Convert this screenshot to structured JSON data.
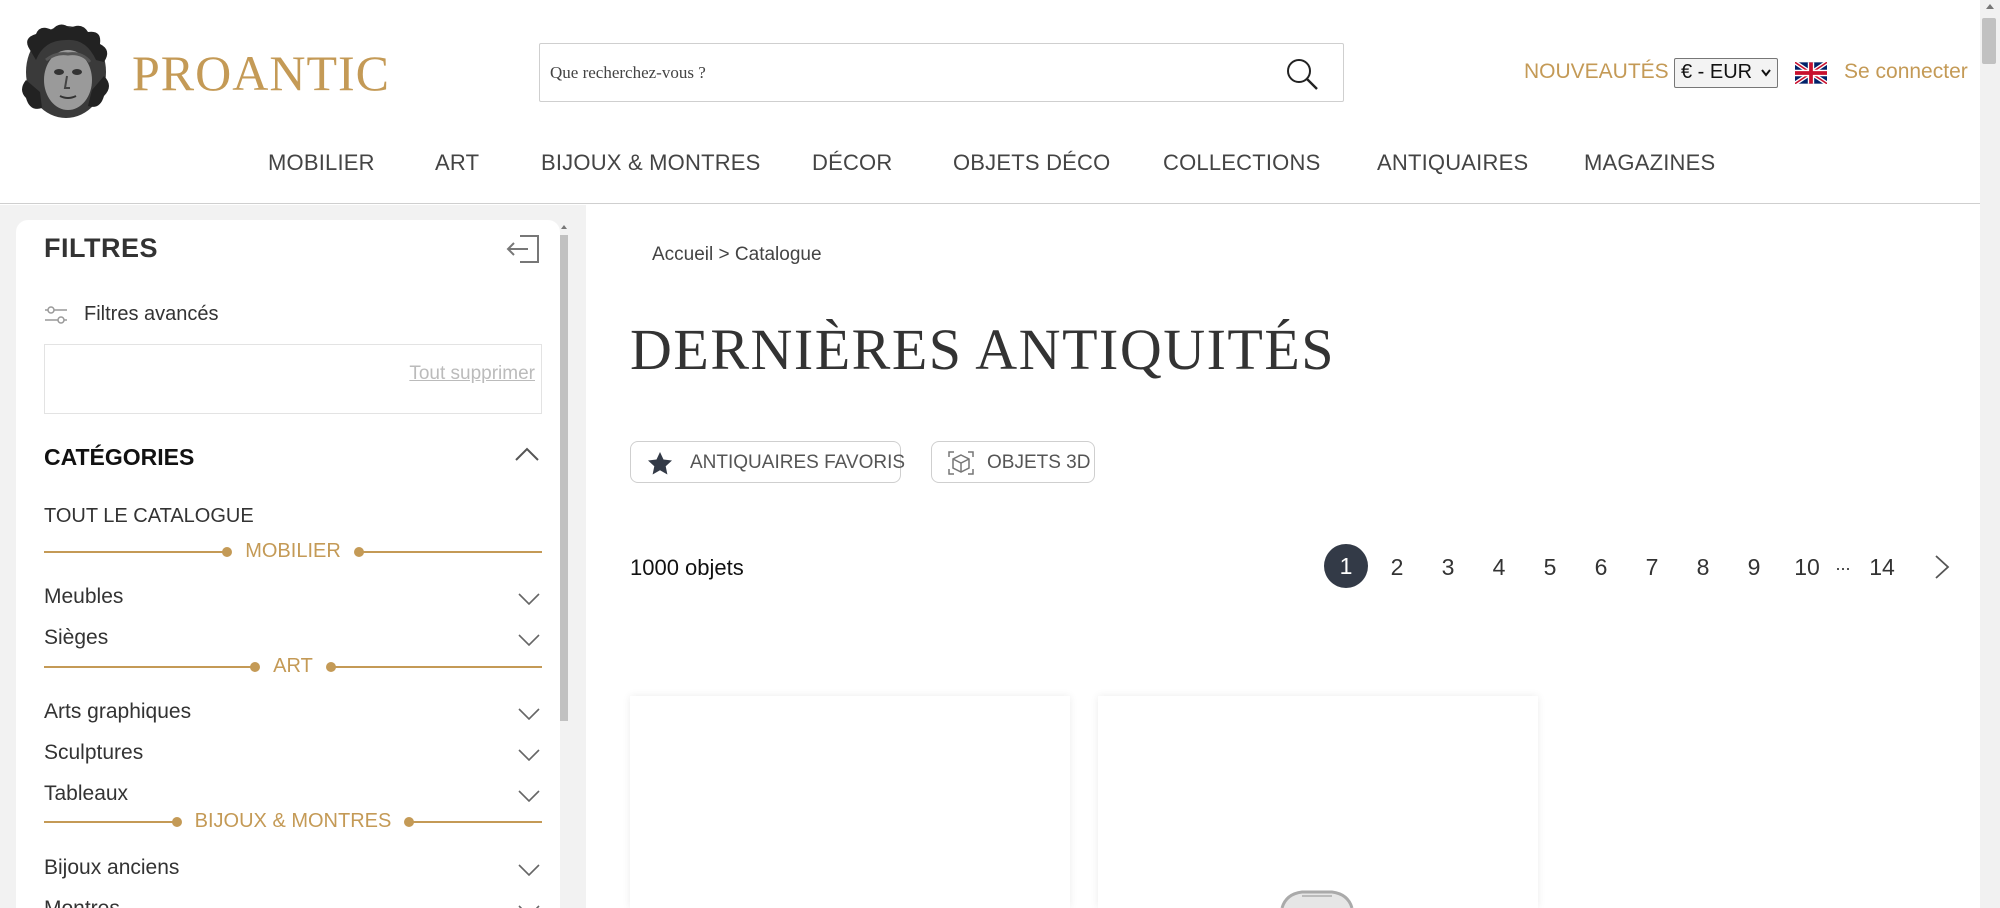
{
  "header": {
    "logo_text": "PROANTIC",
    "search": {
      "placeholder": "Que recherchez-vous ?"
    },
    "new_label": "NOUVEAUTÉS",
    "currency": "€ - EUR",
    "login_label": "Se connecter",
    "brand_color": "#c49a56"
  },
  "nav": {
    "items": [
      "MOBILIER",
      "ART",
      "BIJOUX & MONTRES",
      "DÉCOR",
      "OBJETS DÉCO",
      "COLLECTIONS",
      "ANTIQUAIRES",
      "MAGAZINES"
    ]
  },
  "sidebar": {
    "title": "FILTRES",
    "advanced_filters": "Filtres avancés",
    "clear_all": "Tout supprimer",
    "categories_title": "CATÉGORIES",
    "all_catalog": "TOUT LE CATALOGUE",
    "groups": [
      {
        "label": "MOBILIER",
        "items": [
          "Meubles",
          "Sièges"
        ]
      },
      {
        "label": "ART",
        "items": [
          "Arts graphiques",
          "Sculptures",
          "Tableaux"
        ]
      },
      {
        "label": "BIJOUX & MONTRES",
        "items": [
          "Bijoux anciens",
          "Montres"
        ]
      }
    ]
  },
  "main": {
    "breadcrumb": "Accueil > Catalogue",
    "title": "DERNIÈRES ANTIQUITÉS",
    "pills": [
      "ANTIQUAIRES FAVORIS",
      "OBJETS 3D"
    ],
    "count": "1000 objets",
    "pagination": {
      "current": "1",
      "pages": [
        "2",
        "3",
        "4",
        "5",
        "6",
        "7",
        "8",
        "9",
        "10"
      ],
      "ellipsis": "...",
      "last": "14"
    }
  }
}
